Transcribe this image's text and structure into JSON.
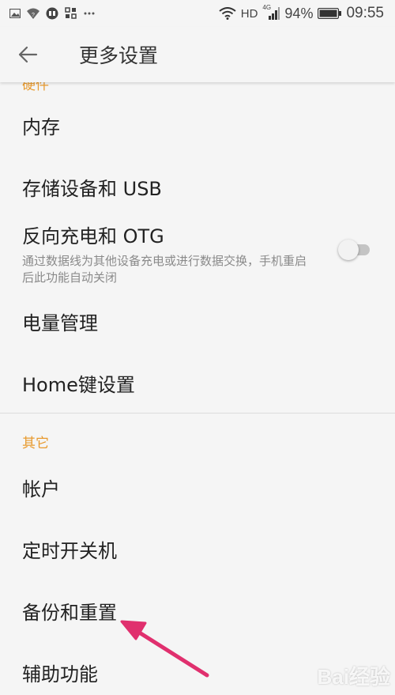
{
  "status_bar": {
    "network": "HD",
    "signal": "4G",
    "battery_percent": "94%",
    "time": "09:55"
  },
  "app_bar": {
    "title": "更多设置"
  },
  "list": {
    "partial_section_header": "硬件",
    "items": [
      {
        "label": "内存"
      },
      {
        "label": "存储设备和 USB"
      },
      {
        "label": "反向充电和 OTG",
        "subtitle": "通过数据线为其他设备充电或进行数据交换，手机重启后此功能自动关闭",
        "toggle_on": false
      },
      {
        "label": "电量管理"
      },
      {
        "label": "Home键设置"
      }
    ],
    "section_other": "其它",
    "other_items": [
      {
        "label": "帐户"
      },
      {
        "label": "定时开关机"
      },
      {
        "label": "备份和重置"
      },
      {
        "label": "辅助功能"
      }
    ]
  },
  "watermark": "Bai经验",
  "colors": {
    "accent": "#e89a2e",
    "annotation_arrow": "#e0306e",
    "background": "#f5f5f5"
  }
}
